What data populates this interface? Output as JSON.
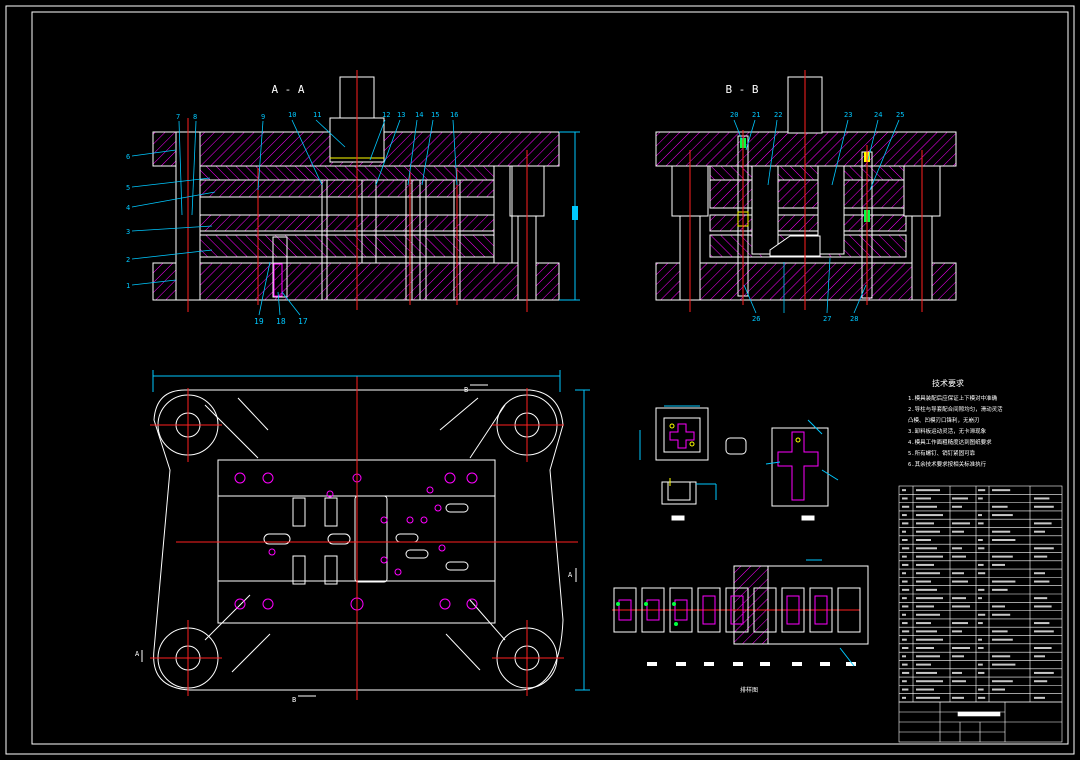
{
  "colors": {
    "background": "#000000",
    "outline": "#ffffff",
    "hatch": "#ff00ff",
    "centerline": "#ff2020",
    "leader": "#00c8ff",
    "dimension": "#00c8ff",
    "accent_green": "#00ff40",
    "accent_yellow": "#ffff00"
  },
  "views": {
    "section_aa_title": "A - A",
    "section_bb_title": "B - B",
    "aa_labels_left": [
      "6",
      "5",
      "4",
      "3",
      "2",
      "1"
    ],
    "aa_labels_top": [
      "7",
      "8",
      "9",
      "10",
      "11",
      "12",
      "13",
      "14",
      "15",
      "16"
    ],
    "aa_labels_bottom": [
      "19",
      "18",
      "17"
    ],
    "bb_labels_top": [
      "20",
      "21",
      "22",
      "23",
      "24",
      "25"
    ],
    "bb_labels_bottom": [
      "26",
      "27",
      "28"
    ],
    "plan_marks": {
      "a_left": "A",
      "a_right": "A",
      "b_top": "B",
      "b_bottom": "B"
    }
  },
  "notes": {
    "title": "技术要求",
    "lines": [
      "1.模具装配后应保证上下模对中准确",
      "2.导柱与导套配合间隙均匀，滑动灵活",
      "  凸模、凹模刃口锋利，无崩刃",
      "3.卸料板运动灵活，无卡滞现象",
      "4.模具工作面粗糙度达到图纸要求",
      "5.所有螺钉、销钉紧固可靠",
      "6.其余技术要求按相关标准执行"
    ]
  },
  "strip_layout_caption": "排样图"
}
